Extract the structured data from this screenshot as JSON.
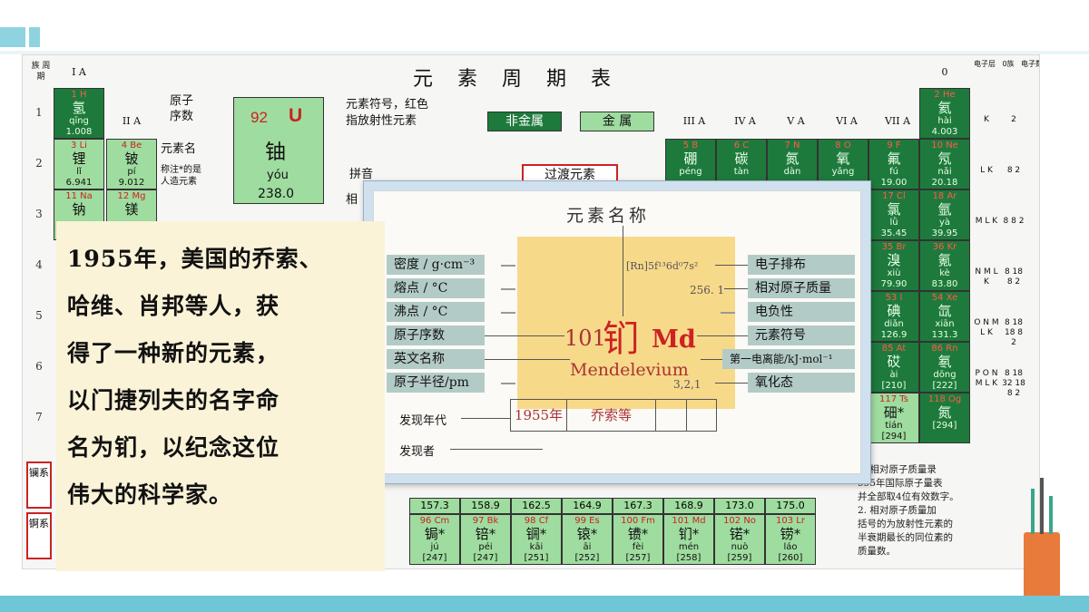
{
  "periodic_table": {
    "title": "元 素 周 期 表",
    "corner_labels": [
      "族",
      "周期"
    ],
    "groups_top": {
      "g1": "I A",
      "g2": "II A",
      "g3": "III A",
      "g4": "IV A",
      "g5": "V A",
      "g6": "VI A",
      "g7": "VII A",
      "g0": "0"
    },
    "shell_headers": [
      "电子层",
      "0族",
      "电子数"
    ],
    "periods": [
      "1",
      "2",
      "3",
      "4",
      "5",
      "6",
      "7"
    ],
    "legend": {
      "atomic_number_label": "原子\n序数",
      "number": "92",
      "symbol": "U",
      "name": "铀",
      "pinyin": "yóu",
      "mass": "238.0",
      "name_label": "元素名",
      "note_label": "称注*的是\n人造元素",
      "symbol_label": "元素符号，红色\n指放射性元素",
      "pinyin_label": "拼音",
      "mass_label": "相"
    },
    "tags": {
      "nonmetal": "非金属",
      "metal": "金 属",
      "transition": "过渡元素"
    },
    "cells": [
      {
        "num": "1",
        "sym": "H",
        "cn": "氢",
        "py": "qīng",
        "mass": "1.008",
        "dark": true
      },
      {
        "num": "3",
        "sym": "Li",
        "cn": "锂",
        "py": "lǐ",
        "mass": "6.941",
        "dark": false
      },
      {
        "num": "4",
        "sym": "Be",
        "cn": "铍",
        "py": "pí",
        "mass": "9.012",
        "dark": false
      },
      {
        "num": "11",
        "sym": "Na",
        "cn": "钠",
        "py": "",
        "mass": "",
        "dark": false
      },
      {
        "num": "12",
        "sym": "Mg",
        "cn": "镁",
        "py": "",
        "mass": "",
        "dark": false
      },
      {
        "num": "2",
        "sym": "He",
        "cn": "氦",
        "py": "hài",
        "mass": "4.003",
        "dark": true
      },
      {
        "num": "10",
        "sym": "Ne",
        "cn": "氖",
        "py": "nǎi",
        "mass": "20.18",
        "dark": true
      },
      {
        "num": "18",
        "sym": "Ar",
        "cn": "氩",
        "py": "yà",
        "mass": "39.95",
        "dark": true
      },
      {
        "num": "36",
        "sym": "Kr",
        "cn": "氪",
        "py": "kè",
        "mass": "83.80",
        "dark": true
      },
      {
        "num": "54",
        "sym": "Xe",
        "cn": "氙",
        "py": "xiān",
        "mass": "131.3",
        "dark": true
      },
      {
        "num": "86",
        "sym": "Rn",
        "cn": "氡",
        "py": "dōng",
        "mass": "[222]",
        "dark": true
      },
      {
        "num": "118",
        "sym": "Og",
        "cn": "氮",
        "py": "",
        "mass": "[294]",
        "dark": true
      },
      {
        "num": "9",
        "sym": "F",
        "cn": "氟",
        "py": "fú",
        "mass": "19.00",
        "dark": true
      },
      {
        "num": "17",
        "sym": "Cl",
        "cn": "氯",
        "py": "lǜ",
        "mass": "35.45",
        "dark": true
      },
      {
        "num": "35",
        "sym": "Br",
        "cn": "溴",
        "py": "xiù",
        "mass": "79.90",
        "dark": true
      },
      {
        "num": "53",
        "sym": "I",
        "cn": "碘",
        "py": "diǎn",
        "mass": "126.9",
        "dark": true
      },
      {
        "num": "85",
        "sym": "At",
        "cn": "砹",
        "py": "ài",
        "mass": "[210]",
        "dark": true
      },
      {
        "num": "117",
        "sym": "Ts",
        "cn": "鿬*",
        "py": "tián",
        "mass": "[294]",
        "dark": false
      },
      {
        "num": "5",
        "sym": "B",
        "cn": "硼",
        "py": "péng",
        "mass": "",
        "dark": true
      },
      {
        "num": "6",
        "sym": "C",
        "cn": "碳",
        "py": "tàn",
        "mass": "",
        "dark": true
      },
      {
        "num": "7",
        "sym": "N",
        "cn": "氮",
        "py": "dàn",
        "mass": "",
        "dark": true
      },
      {
        "num": "8",
        "sym": "O",
        "cn": "氧",
        "py": "yǎng",
        "mass": "",
        "dark": true
      }
    ],
    "shells": [
      "K",
      "L K",
      "M L K",
      "N M L K",
      "O N M L K",
      "P O N M L K"
    ],
    "electrons": [
      "2",
      "8 2",
      "8 8 2",
      "8 18 8 2",
      "8 18 18 8 2",
      "8 18 32 18 8 2"
    ],
    "series_labels": [
      "镧系",
      "锕系"
    ],
    "actinides": [
      {
        "num": "",
        "sym": "",
        "cn": "",
        "mass": "157.3"
      },
      {
        "num": "96",
        "sym": "Cm",
        "cn": "锔*",
        "py": "jú",
        "mass": "[247]"
      },
      {
        "num": "97",
        "sym": "Bk",
        "cn": "锫*",
        "py": "péi",
        "mass": "[247]"
      },
      {
        "num": "98",
        "sym": "Cf",
        "cn": "锎*",
        "py": "kāi",
        "mass": "[251]"
      },
      {
        "num": "99",
        "sym": "Es",
        "cn": "锿*",
        "py": "āi",
        "mass": "[252]"
      },
      {
        "num": "100",
        "sym": "Fm",
        "cn": "镄*",
        "py": "fèi",
        "mass": "[257]"
      },
      {
        "num": "101",
        "sym": "Md",
        "cn": "钔*",
        "py": "mén",
        "mass": "[258]"
      },
      {
        "num": "102",
        "sym": "No",
        "cn": "锘*",
        "py": "nuò",
        "mass": "[259]"
      },
      {
        "num": "103",
        "sym": "Lr",
        "cn": "铹*",
        "py": "láo",
        "mass": "[260]"
      }
    ],
    "lanthanide_masses": [
      "157.3",
      "158.9",
      "162.5",
      "164.9",
      "167.3",
      "168.9",
      "173.0",
      "175.0"
    ],
    "notes": "1. 相对原子质量录\n995年国际原子量表\n并全部取4位有效数字。\n2. 相对原子质量加\n括号的为放射性元素的\n半衰期最长的同位素的\n质量数。"
  },
  "card": {
    "title": "元素名称",
    "left_labels": [
      "密度 / g·cm⁻³",
      "熔点 / °C",
      "沸点 / °C",
      "原子序数",
      "英文名称",
      "原子半径/pm"
    ],
    "right_labels": [
      "电子排布",
      "相对原子质量",
      "电负性",
      "元素符号",
      "第一电离能/kJ·mol⁻¹",
      "氧化态"
    ],
    "electron_config": "[Rn]5f¹³6d⁰7s²",
    "mass": "256. 1",
    "oxidation": "3,2,1",
    "number": "101",
    "name_cn": "钔",
    "symbol": "Md",
    "name_en": "Mendelevium",
    "discovery_year_label": "发现年代",
    "discoverer_label": "发现者",
    "discovery_year": "1955年",
    "discoverer": "乔索等"
  },
  "textbox": {
    "lines": [
      "1955年，美国的乔索、",
      "哈维、肖邦等人，获",
      "得了一种新的元素，",
      "以门捷列夫的名字命",
      "名为钔，以纪念这位",
      "伟大的科学家。"
    ]
  }
}
